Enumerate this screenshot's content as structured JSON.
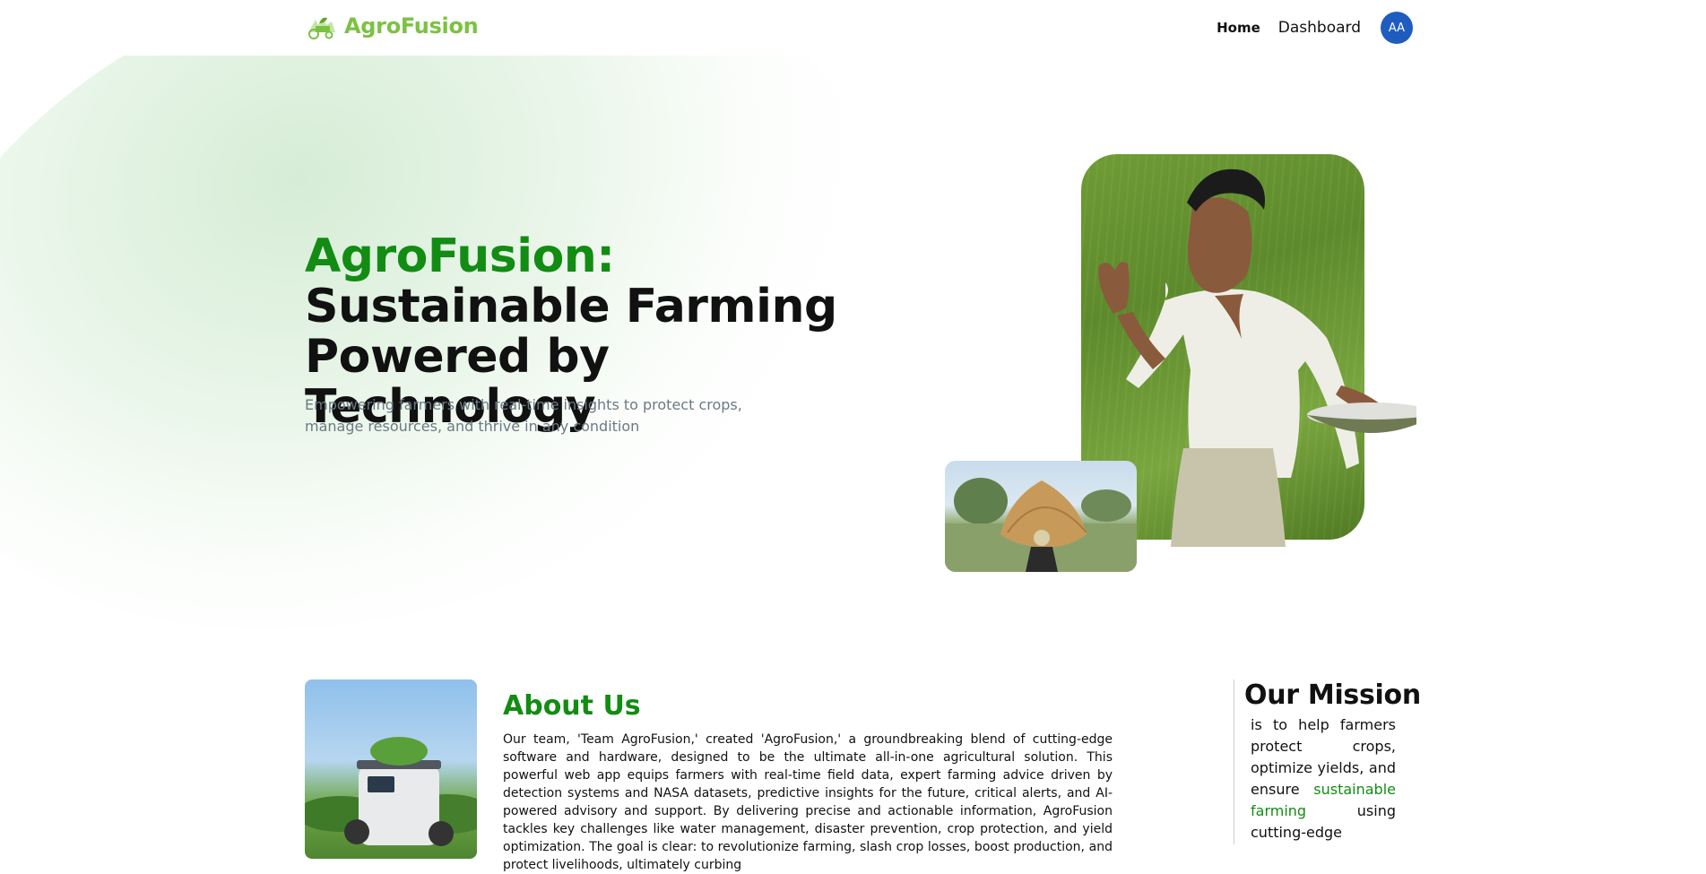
{
  "header": {
    "logo_text": "AgroFusion",
    "nav": [
      {
        "label": "Home",
        "active": true
      },
      {
        "label": "Dashboard",
        "active": false
      }
    ],
    "avatar_initials": "AA"
  },
  "hero": {
    "title_accent": "AgroFusion:",
    "title_rest": " Sustainable Farming Powered by Technology",
    "subtitle": "Empowering farmers with real-time insights to protect crops, manage resources, and thrive in any condition"
  },
  "about": {
    "title": "About Us",
    "text": "Our team, 'Team AgroFusion,' created 'AgroFusion,' a groundbreaking blend of cutting-edge software and hardware, designed to be the ultimate all-in-one agricultural solution. This powerful web app equips farmers with real-time field data, expert farming advice driven by detection systems and NASA datasets, predictive insights for the future, critical alerts, and AI-powered advisory and support. By delivering precise and actionable information, AgroFusion tackles key challenges like water management, disaster prevention, crop protection, and yield optimization. The goal is clear: to revolutionize farming, slash crop losses, boost production, and protect livelihoods, ultimately curbing"
  },
  "mission": {
    "title": "Our Mission",
    "text_before": "is to help farmers protect crops, optimize yields, and ensure ",
    "text_highlight": "sustainable farming",
    "text_after": " using cutting-edge"
  },
  "colors": {
    "brand_green": "#128c13",
    "logo_green": "#7cc242",
    "avatar_blue": "#1f5cc0",
    "subtitle_gray": "#6b7a85"
  },
  "icons": {
    "logo": "tractor-leaf-logo-icon"
  }
}
